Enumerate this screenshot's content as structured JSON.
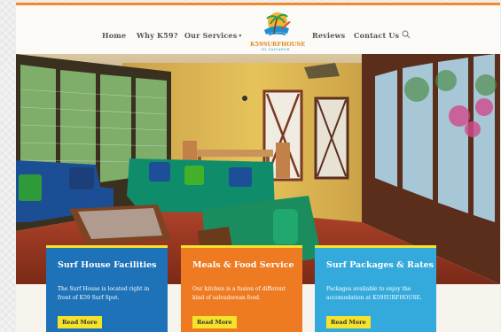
{
  "nav": {
    "items": [
      "Home",
      "Why K59?",
      "Our Services",
      "Reviews",
      "Contact Us"
    ],
    "services_chevron": "▾"
  },
  "logo": {
    "text": "K59SURFHOUSE",
    "subtext": "EL SALVADOR"
  },
  "hero": {
    "description": "Surf house living room with blue and green sofas, wooden dining table and large windows"
  },
  "cards": [
    {
      "title": "Surf House Facilities",
      "body": "The Surf House is located right in front of K59 Surf Spot.",
      "button": "Read More"
    },
    {
      "title": "Meals & Food Service",
      "body": "Our kitchen is a fusion of different kind of salvadorean food.",
      "button": "Read More"
    },
    {
      "title": "Surf Packages & Rates",
      "body": "Packages available to enjoy the accomodation at K59SURFHOUSE.",
      "button": "Read More"
    }
  ],
  "colors": {
    "accent_orange": "#f28c28",
    "card_blue": "#1d72b8",
    "card_orange": "#ee7b22",
    "card_light_blue": "#34aadc",
    "button_yellow": "#f5e22b"
  },
  "icons": [
    "search-icon",
    "chevron-down-icon"
  ]
}
